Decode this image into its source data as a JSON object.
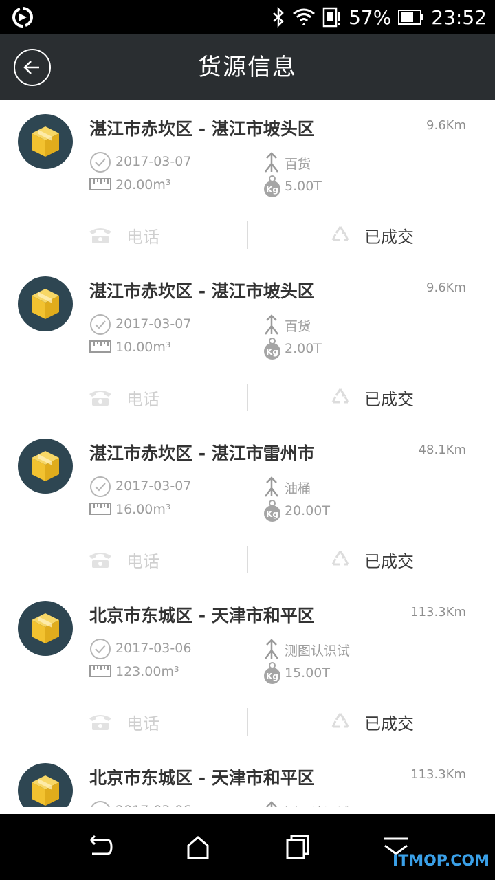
{
  "status_bar": {
    "battery": "57%",
    "time": "23:52",
    "icons": [
      "sync-icon",
      "bluetooth-icon",
      "wifi-icon",
      "sim-alert-icon",
      "battery-icon"
    ]
  },
  "header": {
    "title": "货源信息",
    "back_icon": "back-arrow-icon"
  },
  "cards": [
    {
      "route": "湛江市赤坎区 - 湛江市坡头区",
      "distance": "9.6Km",
      "date": "2017-03-07",
      "goods": "百货",
      "volume": "20.00m³",
      "weight": "5.00T",
      "phone_label": "电话",
      "status_label": "已成交"
    },
    {
      "route": "湛江市赤坎区 - 湛江市坡头区",
      "distance": "9.6Km",
      "date": "2017-03-07",
      "goods": "百货",
      "volume": "10.00m³",
      "weight": "2.00T",
      "phone_label": "电话",
      "status_label": "已成交"
    },
    {
      "route": "湛江市赤坎区 - 湛江市雷州市",
      "distance": "48.1Km",
      "date": "2017-03-07",
      "goods": "油桶",
      "volume": "16.00m³",
      "weight": "20.00T",
      "phone_label": "电话",
      "status_label": "已成交"
    },
    {
      "route": "北京市东城区 - 天津市和平区",
      "distance": "113.3Km",
      "date": "2017-03-06",
      "goods": "测图认识试",
      "volume": "123.00m³",
      "weight": "15.00T",
      "phone_label": "电话",
      "status_label": "已成交"
    },
    {
      "route": "北京市东城区 - 天津市和平区",
      "distance": "113.3Km",
      "date": "2017-03-06",
      "goods": "测图认识试",
      "volume": "",
      "weight": "",
      "phone_label": "",
      "status_label": ""
    }
  ],
  "weight_icon_text": "Kg",
  "nav_bar": {
    "buttons": [
      "back-nav-icon",
      "home-nav-icon",
      "recents-nav-icon",
      "menu-nav-icon"
    ]
  },
  "watermark": "ITMOP.COM",
  "colors": {
    "app_bar": "#2a2e31",
    "avatar_bg": "#2e4652",
    "box_yellow": "#f2c230",
    "text_primary": "#333333",
    "text_secondary": "#9e9e9e"
  }
}
